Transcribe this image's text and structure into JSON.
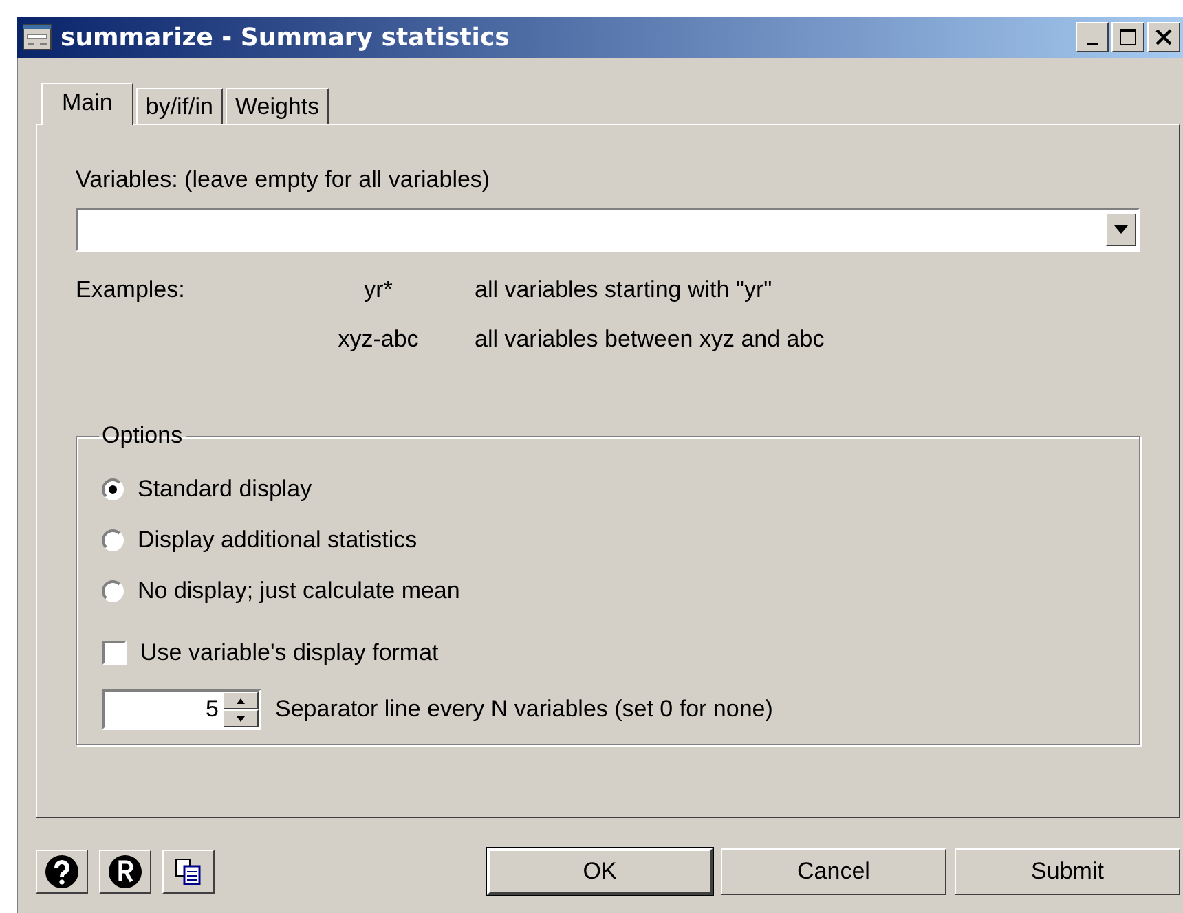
{
  "window": {
    "title": "summarize - Summary statistics"
  },
  "tabs": [
    {
      "label": "Main",
      "selected": true
    },
    {
      "label": "by/if/in",
      "selected": false
    },
    {
      "label": "Weights",
      "selected": false
    }
  ],
  "variables": {
    "label": "Variables: (leave empty for all variables)"
  },
  "examples": {
    "label": "Examples:",
    "rows": [
      {
        "pattern": "yr*",
        "description": "all variables starting with \"yr\""
      },
      {
        "pattern": "xyz-abc",
        "description": "all variables between xyz and abc"
      }
    ]
  },
  "options": {
    "title": "Options",
    "radios": [
      {
        "label": "Standard display",
        "selected": true
      },
      {
        "label": "Display additional statistics",
        "selected": false
      },
      {
        "label": "No display; just calculate mean",
        "selected": false
      }
    ],
    "checkbox": {
      "label": "Use variable's display format",
      "checked": false
    },
    "separator": {
      "value": "5",
      "label": "Separator line every N variables (set 0 for none)"
    }
  },
  "buttons": [
    {
      "label": "OK",
      "default": true
    },
    {
      "label": "Cancel",
      "default": false
    },
    {
      "label": "Submit",
      "default": false
    }
  ]
}
